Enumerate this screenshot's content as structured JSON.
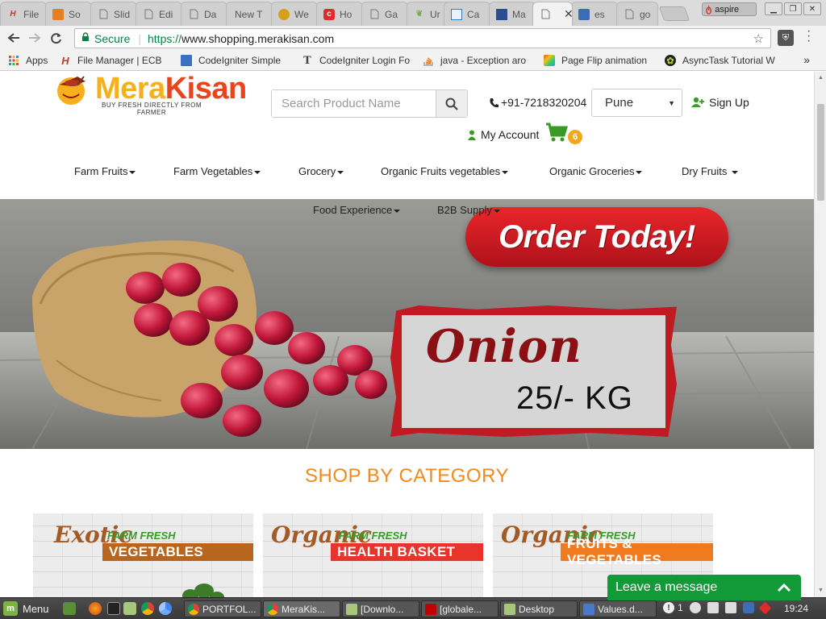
{
  "browser": {
    "tabs": [
      {
        "title": "File",
        "icon": "h-logo-icon",
        "color": "#c0392b"
      },
      {
        "title": "So",
        "icon": "so-logo-icon",
        "color": "#e67e22"
      },
      {
        "title": "Slid",
        "icon": "document-icon",
        "color": "#888888"
      },
      {
        "title": "Edi",
        "icon": "document-icon",
        "color": "#888888"
      },
      {
        "title": "Da",
        "icon": "document-icon",
        "color": "#888888"
      },
      {
        "title": "New T",
        "icon": "",
        "color": "#888888"
      },
      {
        "title": "We",
        "icon": "gold-coin-icon",
        "color": "#d4a017"
      },
      {
        "title": "Ho",
        "icon": "red-c-icon",
        "color": "#e02b2b"
      },
      {
        "title": "Ga",
        "icon": "document-icon",
        "color": "#888888"
      },
      {
        "title": "Ur",
        "icon": "leaf-icon",
        "color": "#7aa84c"
      },
      {
        "title": "Ca",
        "icon": "calendar-icon",
        "color": "#2c7fb8"
      },
      {
        "title": "Ma",
        "icon": "blue-grid-icon",
        "color": "#2a4d8f"
      },
      {
        "title": "",
        "icon": "document-icon",
        "color": "#888888",
        "active": true
      },
      {
        "title": "es",
        "icon": "blue-square-icon",
        "color": "#3b6db3"
      },
      {
        "title": "go",
        "icon": "document-icon",
        "color": "#888888"
      }
    ],
    "profile_name": "aspire",
    "url_secure_label": "Secure",
    "url_scheme": "https://",
    "url_host": "www.shopping.merakisan.com",
    "bookmarks": [
      {
        "label": "Apps",
        "icon": "apps-grid-icon"
      },
      {
        "label": "File Manager | ECB",
        "icon": "h-logo-icon"
      },
      {
        "label": "CodeIgniter Simple",
        "icon": "blue-doc-icon"
      },
      {
        "label": "CodeIgniter Login Fo",
        "icon": "t-letter-icon"
      },
      {
        "label": "java - Exception aro",
        "icon": "stackoverflow-icon"
      },
      {
        "label": "Page Flip animation",
        "icon": "colorful-square-icon"
      },
      {
        "label": "AsyncTask Tutorial W",
        "icon": "android-icon"
      }
    ],
    "bookmarks_more": "»"
  },
  "site": {
    "logo_mera": "Mera",
    "logo_kisan": "Kisan",
    "logo_tagline": "BUY FRESH DIRECTLY FROM FARMER",
    "search_placeholder": "Search Product Name",
    "phone": "+91-7218320204",
    "city": "Pune",
    "signup_label": "Sign Up",
    "account_label": "My Account",
    "cart_count": "6",
    "nav": [
      "Farm Fruits",
      "Farm Vegetables",
      "Grocery",
      "Organic Fruits vegetables",
      "Organic Groceries",
      "Dry Fruits",
      "Food Experience",
      "B2B Supply"
    ],
    "banner": {
      "cta": "Order Today!",
      "product": "Onion",
      "price": "25/- KG"
    },
    "section_title": "SHOP BY CATEGORY",
    "categories": [
      {
        "script": "Exotic",
        "tag": "FARM FRESH",
        "ribbon": "VEGETABLES",
        "ribbon_color": "#b8651f"
      },
      {
        "script": "Organic",
        "tag": "FARM FRESH",
        "ribbon": "HEALTH BASKET",
        "ribbon_color": "#e8342a"
      },
      {
        "script": "Organic",
        "tag": "FARM FRESH",
        "ribbon": "FRUITS & VEGETABLES",
        "ribbon_color": "#f07a1e"
      }
    ],
    "chat_label": "Leave a message"
  },
  "taskbar": {
    "menu_label": "Menu",
    "tasks": [
      {
        "label": "PORTFOL...",
        "icon": "chrome-icon"
      },
      {
        "label": "MeraKis...",
        "icon": "chrome-icon"
      },
      {
        "label": "[Downlo...",
        "icon": "folder-icon"
      },
      {
        "label": "[globale...",
        "icon": "filezilla-icon"
      },
      {
        "label": "Desktop",
        "icon": "folder-icon"
      },
      {
        "label": "Values.d...",
        "icon": "text-editor-icon"
      }
    ],
    "tray_badge": "1",
    "clock": "19:24"
  }
}
